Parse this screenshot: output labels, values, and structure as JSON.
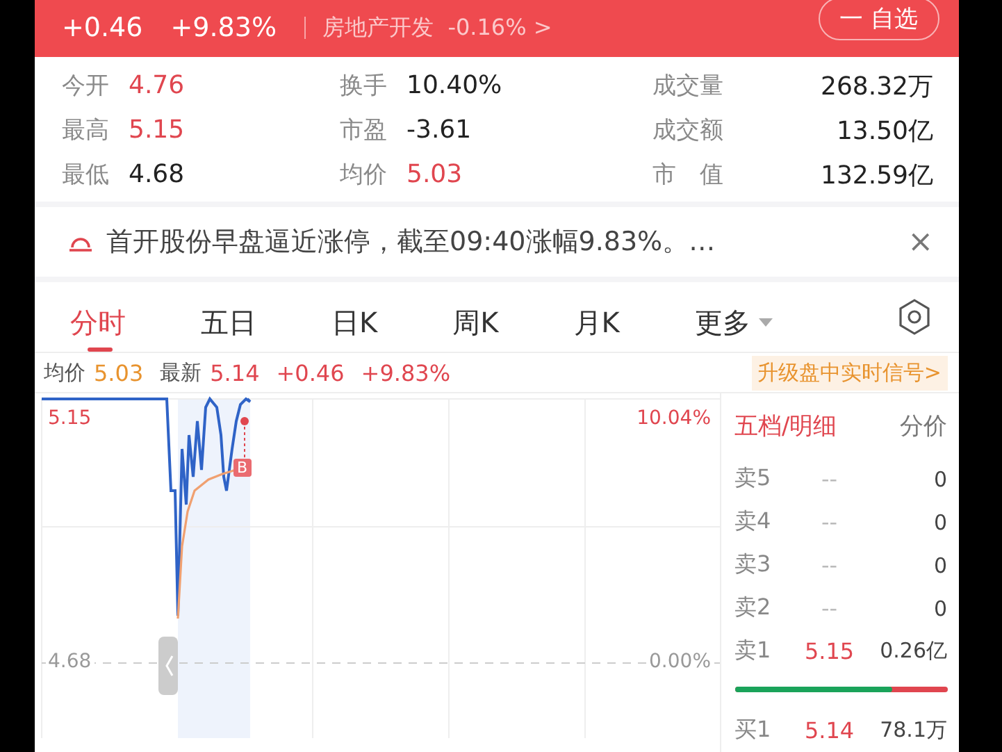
{
  "header": {
    "change": "+0.46",
    "percent": "+9.83%",
    "sector": "房地产开发",
    "sector_change": "-0.16%",
    "sector_arrow": ">",
    "watch_button": "一 自选"
  },
  "stats": [
    {
      "label": "今开",
      "value": "4.76",
      "color": "#e0464f"
    },
    {
      "label": "换手",
      "value": "10.40%",
      "color": "#222222"
    },
    {
      "label": "成交量",
      "value": "268.32万",
      "color": "#222222"
    },
    {
      "label": "最高",
      "value": "5.15",
      "color": "#e0464f"
    },
    {
      "label": "市盈",
      "value": "-3.61",
      "color": "#222222"
    },
    {
      "label": "成交额",
      "value": "13.50亿",
      "color": "#222222"
    },
    {
      "label": "最低",
      "value": "4.68",
      "color": "#222222"
    },
    {
      "label": "均价",
      "value": "5.03",
      "color": "#e0464f"
    },
    {
      "label": "市　值",
      "value": "132.59亿",
      "color": "#222222"
    }
  ],
  "news": {
    "text": "首开股份早盘逼近涨停，截至09:40涨幅9.83%。…",
    "close": "×"
  },
  "tabs": [
    {
      "label": "分时",
      "selected": true
    },
    {
      "label": "五日",
      "selected": false
    },
    {
      "label": "日K",
      "selected": false
    },
    {
      "label": "周K",
      "selected": false
    },
    {
      "label": "月K",
      "selected": false
    },
    {
      "label": "更多",
      "selected": false
    }
  ],
  "quote_line": {
    "avg_label": "均价",
    "avg": "5.03",
    "last_label": "最新",
    "last": "5.14",
    "change": "+0.46",
    "percent": "+9.83%",
    "promo": "升级盘中实时信号>"
  },
  "chart": {
    "top_price": "5.15",
    "top_percent": "10.04%",
    "base_price": "4.68",
    "base_percent": "0.00%",
    "marker": "B"
  },
  "order_book": {
    "tabs": [
      {
        "label": "五档/明细",
        "selected": true
      },
      {
        "label": "分价",
        "selected": false
      }
    ],
    "asks": [
      {
        "label": "卖5",
        "price": "--",
        "volume": "0"
      },
      {
        "label": "卖4",
        "price": "--",
        "volume": "0"
      },
      {
        "label": "卖3",
        "price": "--",
        "volume": "0"
      },
      {
        "label": "卖2",
        "price": "--",
        "volume": "0"
      },
      {
        "label": "卖1",
        "price": "5.15",
        "volume": "0.26亿"
      }
    ],
    "ratio": {
      "level": 0.74
    },
    "bids": [
      {
        "label": "买1",
        "price": "5.14",
        "volume": "78.1万"
      }
    ]
  }
}
